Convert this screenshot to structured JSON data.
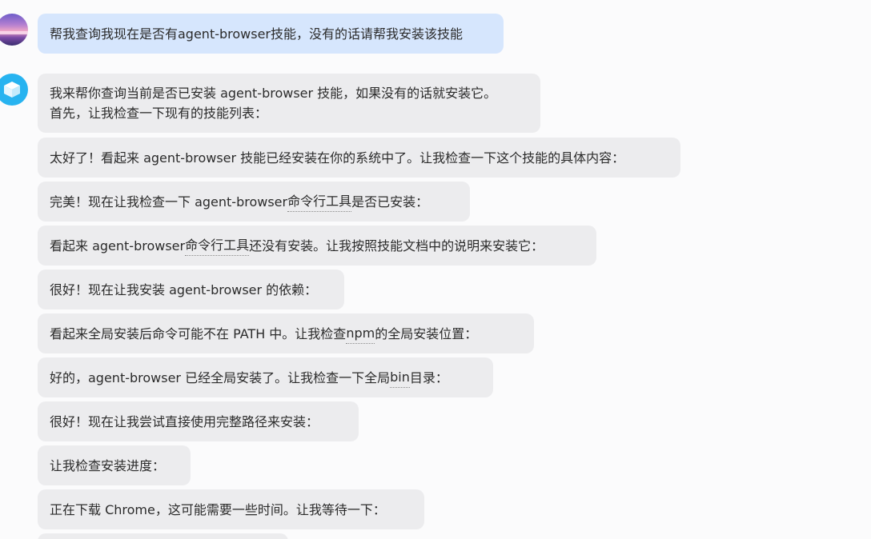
{
  "user_message": "帮我查询我现在是否有agent-browser技能，没有的话请帮我安装该技能",
  "assistant_intro": {
    "line1": "我来帮你查询当前是否已安装 agent-browser 技能，如果没有的话就安装它。",
    "line2": "首先，让我检查一下现有的技能列表："
  },
  "messages": [
    {
      "text": "太好了！看起来 agent-browser 技能已经安装在你的系统中了。让我检查一下这个技能的具体内容："
    },
    {
      "before": "完美！现在让我检查一下 agent-browser ",
      "term": "命令行工具",
      "after": "是否已安装："
    },
    {
      "before": "看起来 agent-browser ",
      "term": "命令行工具",
      "after": "还没有安装。让我按照技能文档中的说明来安装它："
    },
    {
      "text": "很好！现在让我安装 agent-browser 的依赖："
    },
    {
      "before": "看起来全局安装后命令可能不在 PATH 中。让我检查 ",
      "term": "npm",
      "after": " 的全局安装位置："
    },
    {
      "before": "好的，agent-browser 已经全局安装了。让我检查一下全局 ",
      "term": "bin",
      "after": " 目录："
    },
    {
      "text": "很好！现在让我尝试直接使用完整路径来安装："
    },
    {
      "text": "让我检查安装进度："
    },
    {
      "text": "正在下载 Chrome，这可能需要一些时间。让我等待一下："
    }
  ],
  "colors": {
    "background": "#fbfbfc",
    "user_bubble": "#d6e6fd",
    "assistant_bubble": "#ececee",
    "bot_avatar": "#27b3f0"
  },
  "icons": {
    "user_avatar": "sunset-landscape-avatar",
    "bot_avatar": "cube-icon"
  }
}
